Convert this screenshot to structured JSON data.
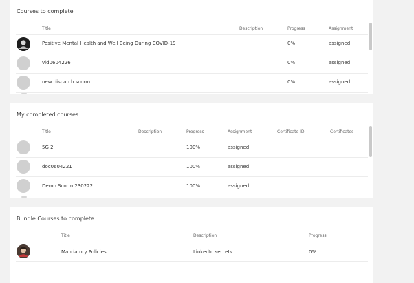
{
  "courses_to_complete": {
    "title": "Courses to complete",
    "headers": {
      "title": "Title",
      "description": "Description",
      "progress": "Progress",
      "assignment": "Assignment"
    },
    "rows": [
      {
        "title": "Positive Mental Health and Well Being During COVID-19",
        "description": "",
        "progress": "0%",
        "assignment": "assigned",
        "avatar": "photo"
      },
      {
        "title": "vid0604226",
        "description": "",
        "progress": "0%",
        "assignment": "assigned",
        "avatar": "placeholder"
      },
      {
        "title": "new dispatch scorm",
        "description": "",
        "progress": "0%",
        "assignment": "assigned",
        "avatar": "placeholder"
      }
    ]
  },
  "completed_courses": {
    "title": "My completed courses",
    "headers": {
      "title": "Title",
      "description": "Description",
      "progress": "Progress",
      "assignment": "Assignment",
      "certificate_id": "Certificate ID",
      "certificates": "Certificates"
    },
    "rows": [
      {
        "title": "5G 2",
        "description": "",
        "progress": "100%",
        "assignment": "assigned",
        "certificate_id": "",
        "certificates": ""
      },
      {
        "title": "doc0604221",
        "description": "",
        "progress": "100%",
        "assignment": "assigned",
        "certificate_id": "",
        "certificates": ""
      },
      {
        "title": "Demo Scorm 230222",
        "description": "",
        "progress": "100%",
        "assignment": "assigned",
        "certificate_id": "",
        "certificates": ""
      }
    ]
  },
  "bundle_courses": {
    "title": "Bundle Courses to complete",
    "headers": {
      "title": "Title",
      "description": "Description",
      "progress": "Progress"
    },
    "rows": [
      {
        "title": "Mandatory Policies",
        "description": "LinkedIn secrets",
        "progress": "0%",
        "avatar": "photo"
      }
    ]
  },
  "colors": {
    "page_bg": "#f2f2f2",
    "panel_bg": "#ffffff",
    "avatar_placeholder": "#d0d0d0",
    "divider": "#ececec"
  }
}
